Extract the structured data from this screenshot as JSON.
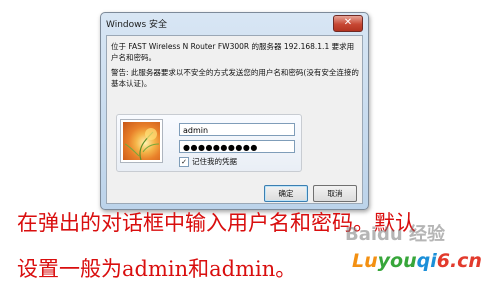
{
  "dialog": {
    "title": "Windows 安全",
    "close_glyph": "✕",
    "message": "位于 FAST Wireless N Router FW300R 的服务器 192.168.1.1 要求用户名和密码。",
    "warning": "警告: 此服务器要求以不安全的方式发送您的用户名和密码(没有安全连接的基本认证)。",
    "username_value": "admin",
    "password_value": "●●●●●●●●●●",
    "remember_checked": true,
    "remember_check_glyph": "✓",
    "remember_label": "记住我的凭据",
    "ok_label": "确定",
    "cancel_label": "取消"
  },
  "caption": {
    "line1": "在弹出的对话框中输入用户名和密码。默认",
    "line2": "设置一般为admin和admin。"
  },
  "watermark": {
    "baidu": "Baidu 经验",
    "site_part1": "Lu",
    "site_part2": "you",
    "site_part3": "qi",
    "site_part4": "6.cn"
  }
}
